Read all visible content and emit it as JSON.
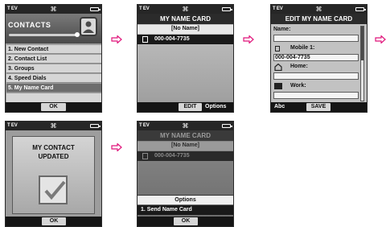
{
  "status": {
    "signal": "T EV",
    "center": "⌘"
  },
  "screen1": {
    "title": "CONTACTS",
    "menu": [
      "1. New Contact",
      "2. Contact List",
      "3. Groups",
      "4. Speed Dials",
      "5. My Name Card"
    ],
    "soft_center": "OK"
  },
  "screen2": {
    "title": "MY NAME CARD",
    "name": "[No Name]",
    "number": "000-004-7735",
    "soft_left": "EDIT",
    "soft_right": "Options"
  },
  "screen3": {
    "title": "EDIT MY NAME CARD",
    "name_label": "Name:",
    "name_value": "",
    "mobile_label": "Mobile 1:",
    "mobile_value": "000-004-7735",
    "home_label": "Home:",
    "home_value": "",
    "work_label": "Work:",
    "work_value": "",
    "soft_left": "Abc",
    "soft_center": "SAVE"
  },
  "screen4": {
    "message_line1": "MY CONTACT",
    "message_line2": "UPDATED",
    "soft_center": "OK"
  },
  "screen5": {
    "title": "MY NAME CARD",
    "name": "[No Name]",
    "number": "000-004-7735",
    "options_title": "Options",
    "option_1": "1.  Send Name Card",
    "soft_center": "OK"
  },
  "colors": {
    "screen_bg": "#b9b9b9",
    "bar_dark": "#262626",
    "selected": "#6d6d6d"
  },
  "icons": [
    "signal-icon",
    "battery-icon",
    "arrow-right-icon",
    "contacts-book-icon",
    "phone-icon",
    "house-icon",
    "work-icon",
    "check-icon"
  ]
}
